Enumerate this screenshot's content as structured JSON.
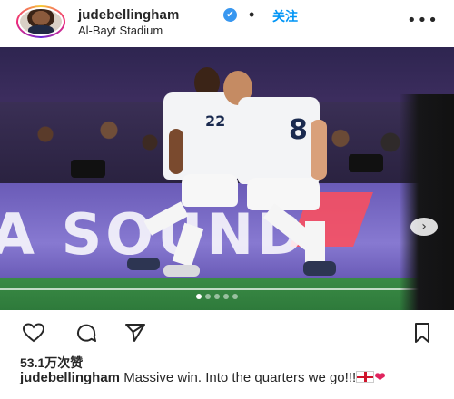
{
  "header": {
    "username": "judebellingham",
    "verified_glyph": "✔",
    "separator": "•",
    "follow_label": "关注",
    "location": "Al-Bayt Stadium",
    "more_glyph": "•••"
  },
  "photo": {
    "board_text": "A SOUND",
    "player1_number": "22",
    "player2_number": "8",
    "next_glyph": "›",
    "pager": {
      "total": 5,
      "active_index": 1
    }
  },
  "actions": {
    "icons": [
      "heart-icon",
      "comment-icon",
      "share-icon",
      "bookmark-icon"
    ]
  },
  "likes_label": "53.1万次赞",
  "caption": {
    "username": "judebellingham",
    "text": "Massive win. Into the quarters we go!!!",
    "emoji_heart": "❤"
  },
  "colors": {
    "follow": "#0095f6",
    "verified": "#3897f0",
    "board": "#7a6bc7",
    "pitch": "#2e7a3b"
  }
}
